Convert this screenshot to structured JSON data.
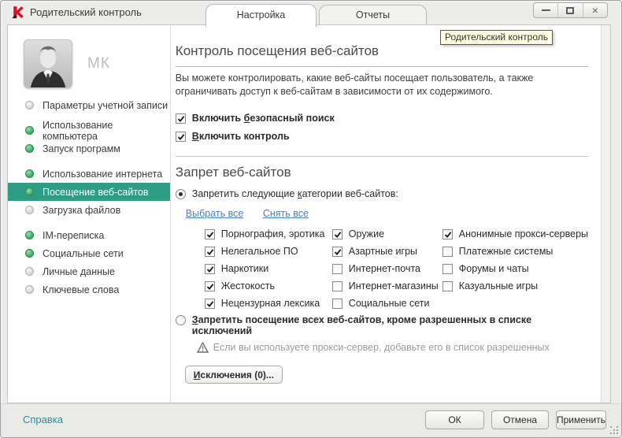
{
  "window": {
    "title": "Родительский контроль"
  },
  "tabs": {
    "settings": "Настройка",
    "reports": "Отчеты"
  },
  "tooltip": {
    "text": "Родительский контроль"
  },
  "sidebar": {
    "user_initials": "МК",
    "items": [
      {
        "label": "Параметры учетной записи",
        "status": "off"
      },
      {
        "label": "Использование компьютера",
        "status": "on"
      },
      {
        "label": "Запуск программ",
        "status": "on"
      },
      {
        "label": "Использование интернета",
        "status": "on"
      },
      {
        "label": "Посещение веб-сайтов",
        "status": "on",
        "selected": true
      },
      {
        "label": "Загрузка файлов",
        "status": "off"
      },
      {
        "label": "IM-переписка",
        "status": "on"
      },
      {
        "label": "Социальные сети",
        "status": "on"
      },
      {
        "label": "Личные данные",
        "status": "off"
      },
      {
        "label": "Ключевые слова",
        "status": "off"
      }
    ]
  },
  "content": {
    "heading": "Контроль посещения веб-сайтов",
    "description": "Вы можете контролировать, какие веб-сайты посещает пользователь, а также ограничивать доступ к веб-сайтам в зависимости от их содержимого.",
    "safe_search": {
      "pre": "Включить ",
      "mn": "б",
      "post": "езопасный поиск",
      "checked": true
    },
    "enable_control": {
      "pre": "",
      "mn": "В",
      "post": "ключить контроль",
      "checked": true
    },
    "section_heading": "Запрет веб-сайтов",
    "radio_categories": {
      "pre": "Запретить следующие ",
      "mn": "к",
      "post": "атегории веб-сайтов:",
      "selected": true
    },
    "select_all": "Выбрать все",
    "clear_all": "Снять все",
    "categories": {
      "col1": [
        {
          "label": "Порнография, эротика",
          "checked": true
        },
        {
          "label": "Нелегальное ПО",
          "checked": true
        },
        {
          "label": "Наркотики",
          "checked": true
        },
        {
          "label": "Жестокость",
          "checked": true
        },
        {
          "label": "Нецензурная лексика",
          "checked": true
        }
      ],
      "col2": [
        {
          "label": "Оружие",
          "checked": true
        },
        {
          "label": "Азартные игры",
          "checked": true
        },
        {
          "label": "Интернет-почта",
          "checked": false
        },
        {
          "label": "Интернет-магазины",
          "checked": false
        },
        {
          "label": "Социальные сети",
          "checked": false
        }
      ],
      "col3": [
        {
          "label": "Анонимные прокси-серверы",
          "checked": true
        },
        {
          "label": "Платежные системы",
          "checked": false
        },
        {
          "label": "Форумы и чаты",
          "checked": false
        },
        {
          "label": "Казуальные игры",
          "checked": false
        }
      ]
    },
    "radio_block_all": {
      "pre": "",
      "mn": "З",
      "post": "апретить посещение всех веб-сайтов, кроме разрешенных в списке исключений",
      "selected": false
    },
    "warning": "Если вы используете прокси-сервер, добавьте его в список разрешенных",
    "exceptions_button": {
      "pre": "",
      "mn": "И",
      "post": "сключения (0)..."
    }
  },
  "footer": {
    "help": "Справка",
    "ok": "ОК",
    "cancel": "Отмена",
    "apply": "Применить"
  },
  "colors": {
    "accent": "#2F9C84",
    "link": "#4A7EBB",
    "help_link": "#2E8C91",
    "tooltip_bg": "#FFFFE1",
    "status_on": "#35A05C",
    "status_off": "#D2D2D0"
  }
}
